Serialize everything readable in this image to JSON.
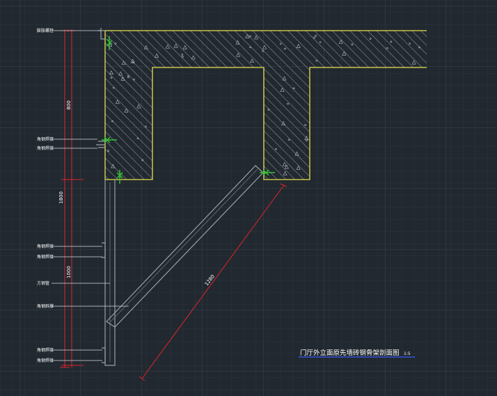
{
  "drawing": {
    "title": "门厅外立面原先墙砖钢骨架剖面图",
    "scale": "1:5",
    "colors": {
      "background": "#212830",
      "grid_minor": "#2b333b",
      "grid_major": "#3a434c",
      "concrete_outline": "#e5e04a",
      "hatch": "#b9bec4",
      "steel_frame": "#9aa0a6",
      "dimension": "#e0262a",
      "leader": "#d8dbde",
      "anchor": "#35c233",
      "text": "#ffffff",
      "title_underline": "#3b5bff"
    }
  },
  "dimensions": {
    "upper_height": "800",
    "total_height": "1800",
    "lower_height": "1000",
    "brace_length": "1280"
  },
  "callouts": {
    "labels": [
      "膨胀螺栓",
      "角钢焊接",
      "角钢焊接",
      "角钢焊接",
      "角钢焊接",
      "方钢管",
      "角钢斜撑",
      "角钢焊接",
      "角钢焊接"
    ]
  }
}
